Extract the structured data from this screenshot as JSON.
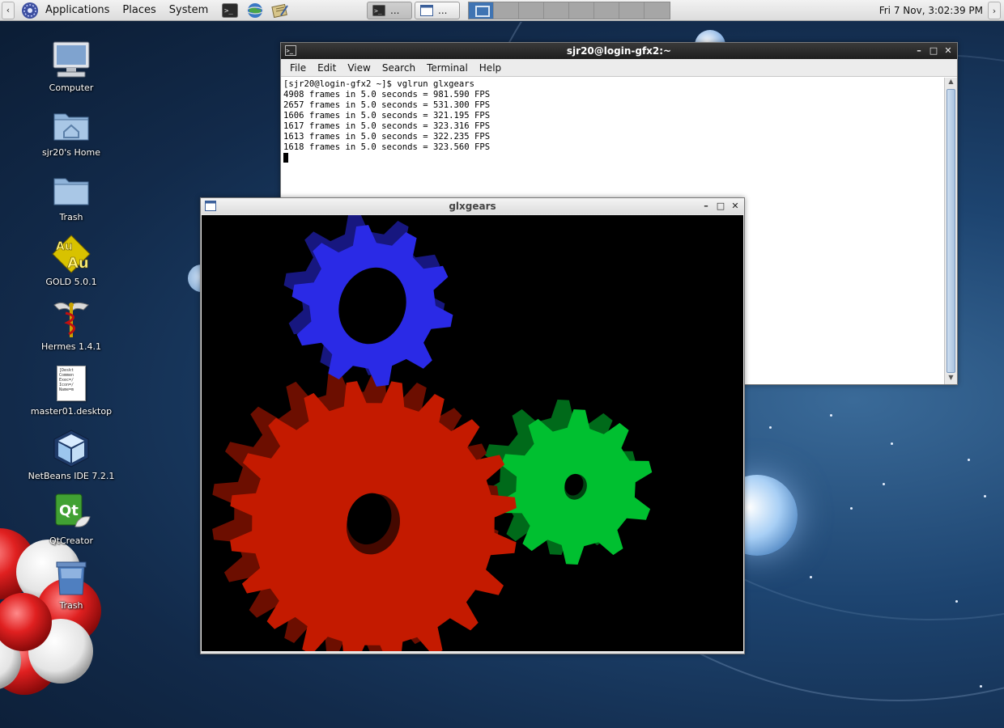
{
  "top_panel": {
    "menus": [
      "Applications",
      "Places",
      "System"
    ],
    "launchers": [
      "terminal-launcher-icon",
      "web-browser-icon",
      "notes-editor-icon"
    ],
    "tasks": [
      {
        "label": "...",
        "icon": "terminal-icon"
      },
      {
        "label": "...",
        "icon": "window-icon"
      }
    ],
    "workspace_count": 8,
    "current_workspace": 1,
    "clock": "Fri  7 Nov,  3:02:39 PM"
  },
  "desktop_icons": [
    {
      "label": "Computer",
      "icon": "computer-icon"
    },
    {
      "label": "sjr20's Home",
      "icon": "home-folder-icon"
    },
    {
      "label": "Trash",
      "icon": "trash-folder-icon"
    },
    {
      "label": "GOLD 5.0.1",
      "icon": "gold-app-icon"
    },
    {
      "label": "Hermes 1.4.1",
      "icon": "hermes-app-icon"
    },
    {
      "label": "master01.desktop",
      "icon": "desktop-file-icon"
    },
    {
      "label": "NetBeans IDE 7.2.1",
      "icon": "netbeans-icon"
    },
    {
      "label": "QtCreator",
      "icon": "qtcreator-icon"
    },
    {
      "label": "Trash",
      "icon": "trash-bin-icon"
    }
  ],
  "desktop_file_preview": "[Deskt\nCommen\nExec=/\nIcon=/\nName=m",
  "terminal": {
    "title": "sjr20@login-gfx2:~",
    "menu": [
      "File",
      "Edit",
      "View",
      "Search",
      "Terminal",
      "Help"
    ],
    "lines": [
      "[sjr20@login-gfx2 ~]$ vglrun glxgears",
      "4908 frames in 5.0 seconds = 981.590 FPS",
      "2657 frames in 5.0 seconds = 531.300 FPS",
      "1606 frames in 5.0 seconds = 321.195 FPS",
      "1617 frames in 5.0 seconds = 323.316 FPS",
      "1613 frames in 5.0 seconds = 322.235 FPS",
      "1618 frames in 5.0 seconds = 323.560 FPS"
    ]
  },
  "glxgears": {
    "title": "glxgears",
    "gears": [
      {
        "name": "red-gear",
        "teeth": 20,
        "color": "#c41a00"
      },
      {
        "name": "green-gear",
        "teeth": 10,
        "color": "#00c030"
      },
      {
        "name": "blue-gear",
        "teeth": 10,
        "color": "#2a2ae6"
      }
    ]
  },
  "colors": {
    "terminal_titlebar": "#2a2a2a",
    "panel_bg": "#e6e6e6",
    "workspace_active": "#3f74b3"
  }
}
